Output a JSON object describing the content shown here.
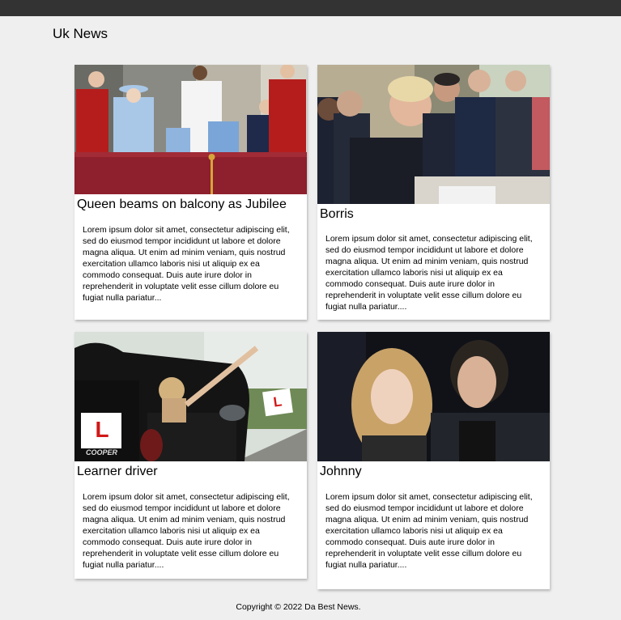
{
  "header": {
    "title": "Uk News"
  },
  "articles": [
    {
      "headline": "Queen beams on balcony as Jubilee",
      "body": "Lorem ipsum dolor sit amet, consectetur adipiscing elit, sed do eiusmod tempor incididunt ut labore et dolore magna aliqua. Ut enim ad minim veniam, quis nostrud exercitation ullamco laboris nisi ut aliquip ex ea commodo consequat. Duis aute irure dolor in reprehenderit in voluptate velit esse cillum dolore eu fugiat nulla pariatur...",
      "image_icon": "royal-balcony-photo"
    },
    {
      "headline": "Borris",
      "body": "Lorem ipsum dolor sit amet, consectetur adipiscing elit, sed do eiusmod tempor incididunt ut labore et dolore magna aliqua. Ut enim ad minim veniam, quis nostrud exercitation ullamco laboris nisi ut aliquip ex ea commodo consequat. Duis aute irure dolor in reprehenderit in voluptate velit esse cillum dolore eu fugiat nulla pariatur....",
      "image_icon": "cabinet-meeting-photo"
    },
    {
      "headline": "Learner driver",
      "body": "Lorem ipsum dolor sit amet, consectetur adipiscing elit, sed do eiusmod tempor incididunt ut labore et dolore magna aliqua. Ut enim ad minim veniam, quis nostrud exercitation ullamco laboris nisi ut aliquip ex ea commodo consequat. Duis aute irure dolor in reprehenderit in voluptate velit esse cillum dolore eu fugiat nulla pariatur....",
      "image_icon": "learner-driver-car-photo",
      "plate_letter": "L",
      "car_badge": "COOPER"
    },
    {
      "headline": "Johnny",
      "body": "Lorem ipsum dolor sit amet, consectetur adipiscing elit, sed do eiusmod tempor incididunt ut labore et dolore magna aliqua. Ut enim ad minim veniam, quis nostrud exercitation ullamco laboris nisi ut aliquip ex ea commodo consequat. Duis aute irure dolor in reprehenderit in voluptate velit esse cillum dolore eu fugiat nulla pariatur....",
      "image_icon": "celebrity-couple-photo"
    }
  ],
  "footer": {
    "copyright": "Copyright © 2022 Da Best News."
  },
  "colors": {
    "topbar": "#333333",
    "background": "#efefef",
    "card": "#ffffff"
  }
}
